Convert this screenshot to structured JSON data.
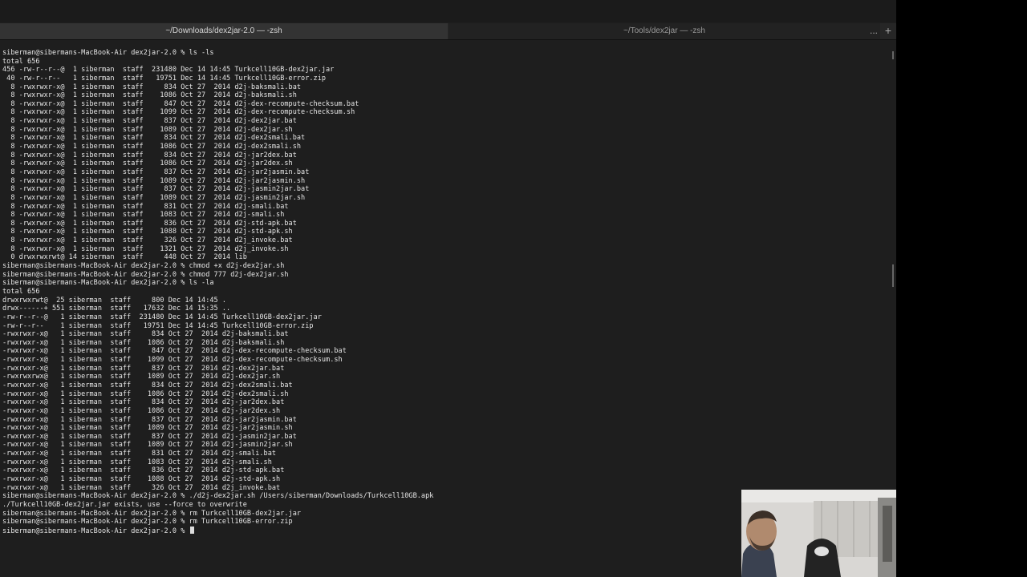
{
  "tabs": [
    {
      "title": "~/Downloads/dex2jar-2.0 — -zsh"
    },
    {
      "title": "~/Tools/dex2jar — -zsh"
    }
  ],
  "tab_more_glyph": "...",
  "tab_add_glyph": "+",
  "terminal_lines": [
    "siberman@sibermans-MacBook-Air dex2jar-2.0 % ls -ls",
    "total 656",
    "456 -rw-r--r--@  1 siberman  staff  231480 Dec 14 14:45 Turkcell10GB-dex2jar.jar",
    " 40 -rw-r--r--   1 siberman  staff   19751 Dec 14 14:45 Turkcell10GB-error.zip",
    "  8 -rwxrwxr-x@  1 siberman  staff     834 Oct 27  2014 d2j-baksmali.bat",
    "  8 -rwxrwxr-x@  1 siberman  staff    1086 Oct 27  2014 d2j-baksmali.sh",
    "  8 -rwxrwxr-x@  1 siberman  staff     847 Oct 27  2014 d2j-dex-recompute-checksum.bat",
    "  8 -rwxrwxr-x@  1 siberman  staff    1099 Oct 27  2014 d2j-dex-recompute-checksum.sh",
    "  8 -rwxrwxr-x@  1 siberman  staff     837 Oct 27  2014 d2j-dex2jar.bat",
    "  8 -rwxrwxr-x@  1 siberman  staff    1089 Oct 27  2014 d2j-dex2jar.sh",
    "  8 -rwxrwxr-x@  1 siberman  staff     834 Oct 27  2014 d2j-dex2smali.bat",
    "  8 -rwxrwxr-x@  1 siberman  staff    1086 Oct 27  2014 d2j-dex2smali.sh",
    "  8 -rwxrwxr-x@  1 siberman  staff     834 Oct 27  2014 d2j-jar2dex.bat",
    "  8 -rwxrwxr-x@  1 siberman  staff    1086 Oct 27  2014 d2j-jar2dex.sh",
    "  8 -rwxrwxr-x@  1 siberman  staff     837 Oct 27  2014 d2j-jar2jasmin.bat",
    "  8 -rwxrwxr-x@  1 siberman  staff    1089 Oct 27  2014 d2j-jar2jasmin.sh",
    "  8 -rwxrwxr-x@  1 siberman  staff     837 Oct 27  2014 d2j-jasmin2jar.bat",
    "  8 -rwxrwxr-x@  1 siberman  staff    1089 Oct 27  2014 d2j-jasmin2jar.sh",
    "  8 -rwxrwxr-x@  1 siberman  staff     831 Oct 27  2014 d2j-smali.bat",
    "  8 -rwxrwxr-x@  1 siberman  staff    1083 Oct 27  2014 d2j-smali.sh",
    "  8 -rwxrwxr-x@  1 siberman  staff     836 Oct 27  2014 d2j-std-apk.bat",
    "  8 -rwxrwxr-x@  1 siberman  staff    1088 Oct 27  2014 d2j-std-apk.sh",
    "  8 -rwxrwxr-x@  1 siberman  staff     326 Oct 27  2014 d2j_invoke.bat",
    "  8 -rwxrwxr-x@  1 siberman  staff    1321 Oct 27  2014 d2j_invoke.sh",
    "  0 drwxrwxrwt@ 14 siberman  staff     448 Oct 27  2014 lib",
    "siberman@sibermans-MacBook-Air dex2jar-2.0 % chmod +x d2j-dex2jar.sh",
    "siberman@sibermans-MacBook-Air dex2jar-2.0 % chmod 777 d2j-dex2jar.sh",
    "siberman@sibermans-MacBook-Air dex2jar-2.0 % ls -la",
    "total 656",
    "drwxrwxrwt@  25 siberman  staff     800 Dec 14 14:45 .",
    "drwx------+ 551 siberman  staff   17632 Dec 14 15:35 ..",
    "-rw-r--r--@   1 siberman  staff  231480 Dec 14 14:45 Turkcell10GB-dex2jar.jar",
    "-rw-r--r--    1 siberman  staff   19751 Dec 14 14:45 Turkcell10GB-error.zip",
    "-rwxrwxr-x@   1 siberman  staff     834 Oct 27  2014 d2j-baksmali.bat",
    "-rwxrwxr-x@   1 siberman  staff    1086 Oct 27  2014 d2j-baksmali.sh",
    "-rwxrwxr-x@   1 siberman  staff     847 Oct 27  2014 d2j-dex-recompute-checksum.bat",
    "-rwxrwxr-x@   1 siberman  staff    1099 Oct 27  2014 d2j-dex-recompute-checksum.sh",
    "-rwxrwxr-x@   1 siberman  staff     837 Oct 27  2014 d2j-dex2jar.bat",
    "-rwxrwxrwx@   1 siberman  staff    1089 Oct 27  2014 d2j-dex2jar.sh",
    "-rwxrwxr-x@   1 siberman  staff     834 Oct 27  2014 d2j-dex2smali.bat",
    "-rwxrwxr-x@   1 siberman  staff    1086 Oct 27  2014 d2j-dex2smali.sh",
    "-rwxrwxr-x@   1 siberman  staff     834 Oct 27  2014 d2j-jar2dex.bat",
    "-rwxrwxr-x@   1 siberman  staff    1086 Oct 27  2014 d2j-jar2dex.sh",
    "-rwxrwxr-x@   1 siberman  staff     837 Oct 27  2014 d2j-jar2jasmin.bat",
    "-rwxrwxr-x@   1 siberman  staff    1089 Oct 27  2014 d2j-jar2jasmin.sh",
    "-rwxrwxr-x@   1 siberman  staff     837 Oct 27  2014 d2j-jasmin2jar.bat",
    "-rwxrwxr-x@   1 siberman  staff    1089 Oct 27  2014 d2j-jasmin2jar.sh",
    "-rwxrwxr-x@   1 siberman  staff     831 Oct 27  2014 d2j-smali.bat",
    "-rwxrwxr-x@   1 siberman  staff    1083 Oct 27  2014 d2j-smali.sh",
    "-rwxrwxr-x@   1 siberman  staff     836 Oct 27  2014 d2j-std-apk.bat",
    "-rwxrwxr-x@   1 siberman  staff    1088 Oct 27  2014 d2j-std-apk.sh",
    "-rwxrwxr-x@   1 siberman  staff     326 Oct 27  2014 d2j_invoke.bat",
    "siberman@sibermans-MacBook-Air dex2jar-2.0 % ./d2j-dex2jar.sh /Users/siberman/Downloads/Turkcell10GB.apk",
    "./Turkcell10GB-dex2jar.jar exists, use --force to overwrite",
    "siberman@sibermans-MacBook-Air dex2jar-2.0 % rm Turkcell10GB-dex2jar.jar",
    "siberman@sibermans-MacBook-Air dex2jar-2.0 % rm Turkcell10GB-error.zip",
    "siberman@sibermans-MacBook-Air dex2jar-2.0 % "
  ],
  "colors": {
    "terminal_bg": "#1e1e1e",
    "terminal_fg": "#e6e6e6",
    "status_dot": "#28c840"
  }
}
